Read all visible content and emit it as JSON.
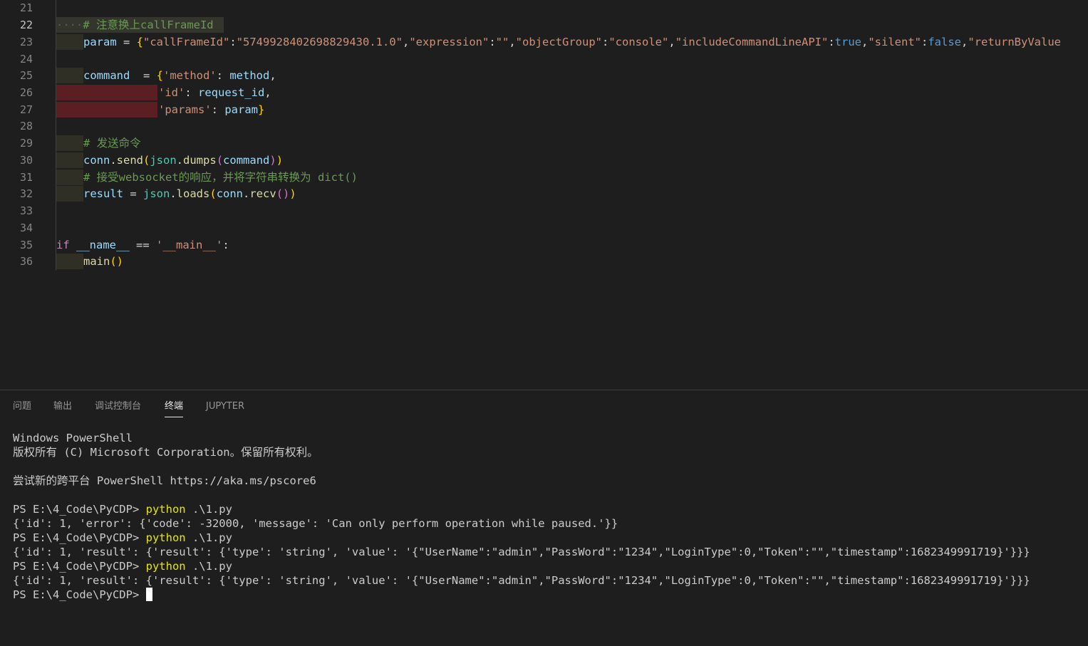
{
  "editor": {
    "lines": [
      {
        "num": "21"
      },
      {
        "num": "22",
        "dots": "····",
        "comment": "# 注意换上callFrameId"
      },
      {
        "num": "23",
        "param": "param",
        "eq": " = ",
        "obj_open": "{",
        "k1": "\"callFrameId\"",
        "colon": ":",
        "v1": "\"5749928402698829430.1.0\"",
        "comma": ",",
        "k2": "\"expression\"",
        "v2": "\"\"",
        "k3": "\"objectGroup\"",
        "v3": "\"console\"",
        "k4": "\"includeCommandLineAPI\"",
        "v4": "true",
        "k5": "\"silent\"",
        "v5": "false",
        "k6": "\"returnByValue"
      },
      {
        "num": "24"
      },
      {
        "num": "25",
        "var": "command",
        "eq": "  = ",
        "brace": "{",
        "key": "'method'",
        "colon": ": ",
        "val": "method",
        "comma": ","
      },
      {
        "num": "26",
        "key": "'id'",
        "colon": ": ",
        "val": "request_id",
        "comma": ","
      },
      {
        "num": "27",
        "key": "'params'",
        "colon": ": ",
        "val": "param",
        "brace": "}"
      },
      {
        "num": "28"
      },
      {
        "num": "29",
        "comment": "# 发送命令"
      },
      {
        "num": "30",
        "obj": "conn",
        "dot": ".",
        "fn": "send",
        "po": "(",
        "mod": "json",
        "dot2": ".",
        "fn2": "dumps",
        "po2": "(",
        "arg": "command",
        "pc2": ")",
        "pc": ")"
      },
      {
        "num": "31",
        "comment": "# 接受websocket的响应，并将字符串转换为 dict()"
      },
      {
        "num": "32",
        "var": "result",
        "eq": " = ",
        "mod": "json",
        "dot": ".",
        "fn": "loads",
        "po": "(",
        "obj": "conn",
        "dot2": ".",
        "fn2": "recv",
        "po2": "(",
        "pc2": ")",
        "pc": ")"
      },
      {
        "num": "33"
      },
      {
        "num": "34"
      },
      {
        "num": "35",
        "kw": "if",
        "sp": " ",
        "name": "__name__",
        "op": " == ",
        "str": "'__main__'",
        "colon": ":"
      },
      {
        "num": "36",
        "fn": "main",
        "po": "(",
        "pc": ")"
      }
    ]
  },
  "panel": {
    "tabs": [
      "问题",
      "输出",
      "调试控制台",
      "终端",
      "JUPYTER"
    ],
    "active_tab": "终端",
    "terminal": {
      "l1": "Windows PowerShell",
      "l2": "版权所有 (C) Microsoft Corporation。保留所有权利。",
      "l3": "",
      "l4": "尝试新的跨平台 PowerShell https://aka.ms/pscore6",
      "l5": "",
      "prompt": "PS E:\\4_Code\\PyCDP> ",
      "cmd": "python",
      "arg": " .\\1.py",
      "out1": "{'id': 1, 'error': {'code': -32000, 'message': 'Can only perform operation while paused.'}}",
      "out2": "{'id': 1, 'result': {'result': {'type': 'string', 'value': '{\"UserName\":\"admin\",\"PassWord\":\"1234\",\"LoginType\":0,\"Token\":\"\",\"timestamp\":1682349991719}'}}}",
      "out3": "{'id': 1, 'result': {'result': {'type': 'string', 'value': '{\"UserName\":\"admin\",\"PassWord\":\"1234\",\"LoginType\":0,\"Token\":\"\",\"timestamp\":1682349991719}'}}}"
    }
  },
  "colors": {
    "background": "#1e1e1e",
    "keyword": "#569cd6",
    "string": "#ce9178",
    "variable": "#9cdcfe",
    "function": "#dcdcaa",
    "comment": "#6a9955",
    "terminal_command": "#e5e510"
  }
}
